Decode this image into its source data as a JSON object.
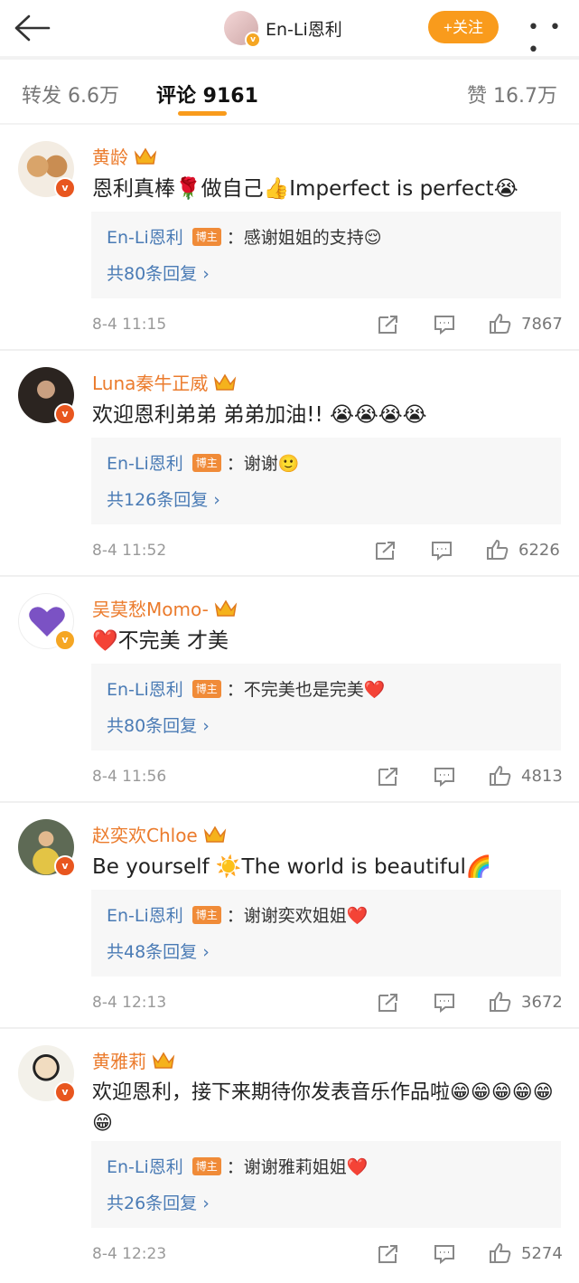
{
  "header": {
    "author_name": "En-Li恩利",
    "follow_label": "+关注",
    "more_label": "• • •"
  },
  "tabs": {
    "repost": "转发 6.6万",
    "comments": "评论 9161",
    "likes": "赞 16.7万"
  },
  "comments": [
    {
      "name": "黄龄",
      "text": "恩利真棒🌹做自己👍Imperfect is perfect😭",
      "reply_author": "En-Li恩利",
      "reply_badge": "博主",
      "reply_text": "：感谢姐姐的支持😌",
      "reply_count": "共80条回复 ›",
      "time": "8-4 11:15",
      "likes": "7867"
    },
    {
      "name": "Luna秦牛正威",
      "text": "欢迎恩利弟弟 弟弟加油!! 😭😭😭😭",
      "reply_author": "En-Li恩利",
      "reply_badge": "博主",
      "reply_text": "：谢谢🙂",
      "reply_count": "共126条回复 ›",
      "time": "8-4 11:52",
      "likes": "6226"
    },
    {
      "name": "吴莫愁Momo-",
      "text": "❤️不完美 才美",
      "reply_author": "En-Li恩利",
      "reply_badge": "博主",
      "reply_text": "：不完美也是完美❤️",
      "reply_count": "共80条回复 ›",
      "time": "8-4 11:56",
      "likes": "4813"
    },
    {
      "name": "赵奕欢Chloe",
      "text": "Be yourself ☀️The world is beautiful🌈",
      "reply_author": "En-Li恩利",
      "reply_badge": "博主",
      "reply_text": "：谢谢奕欢姐姐❤️",
      "reply_count": "共48条回复 ›",
      "time": "8-4 12:13",
      "likes": "3672"
    },
    {
      "name": "黄雅莉",
      "text": "欢迎恩利，接下来期待你发表音乐作品啦😁😁😁😁😁😁",
      "reply_author": "En-Li恩利",
      "reply_badge": "博主",
      "reply_text": "：谢谢雅莉姐姐❤️",
      "reply_count": "共26条回复 ›",
      "time": "8-4 12:23",
      "likes": "5274"
    }
  ],
  "colors": {
    "accent": "#f99b1c",
    "name": "#eb7b2c",
    "link": "#4a7bb5",
    "badge": "#f08b38",
    "verified": "#e8561f"
  },
  "icons": [
    "back-arrow-icon",
    "verified-icon",
    "crown-icon",
    "share-icon",
    "comment-icon",
    "like-icon",
    "more-icon"
  ]
}
